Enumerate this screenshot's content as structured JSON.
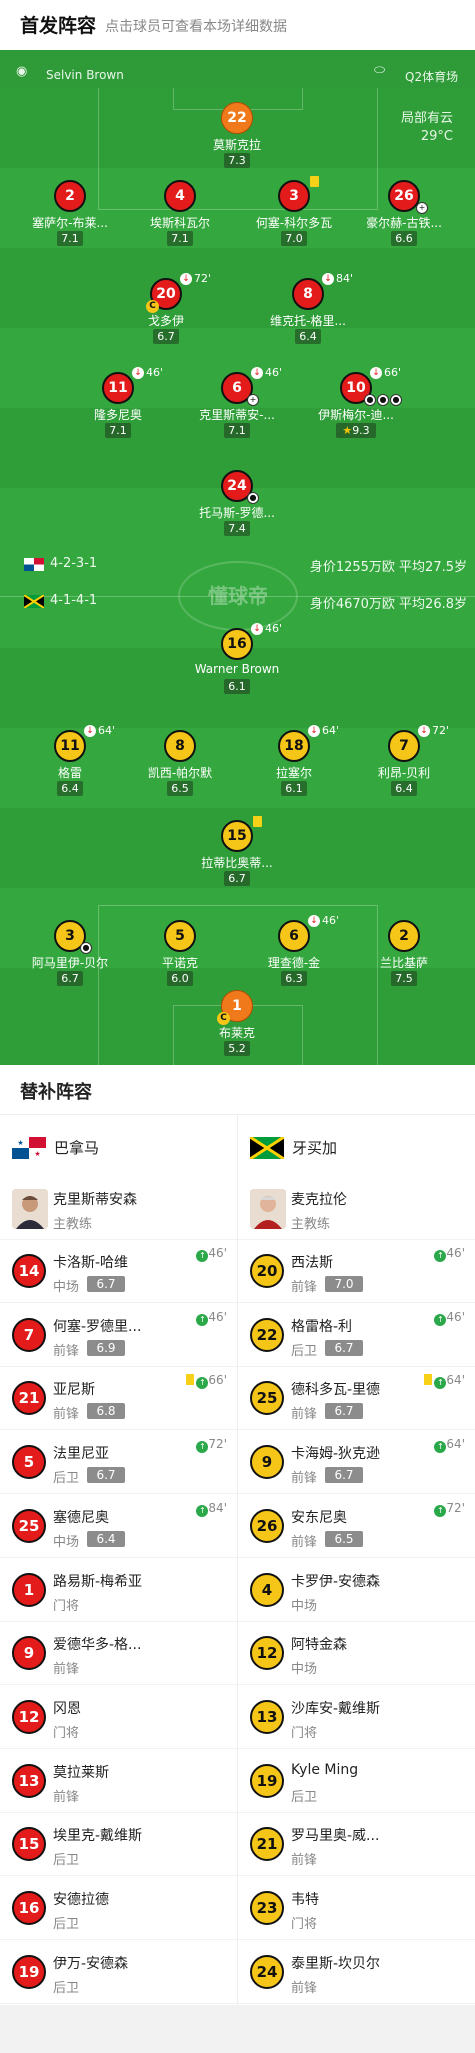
{
  "header": {
    "title": "首发阵容",
    "subtitle": "点击球员可查看本场详细数据"
  },
  "pitch": {
    "referee": "Selvin Brown",
    "venue": "Q2体育场",
    "weather_1": "局部有云",
    "weather_2": "29°C",
    "home": {
      "formation": "4-2-3-1",
      "value": "身价1255万欧 平均27.5岁"
    },
    "away": {
      "formation": "4-1-4-1",
      "value": "身价4670万欧 平均26.8岁"
    },
    "watermark": "懂球帝"
  },
  "home_players": [
    {
      "num": "22",
      "name": "莫斯克拉",
      "rating": "7.3"
    },
    {
      "num": "2",
      "name": "塞萨尔-布莱...",
      "rating": "7.1"
    },
    {
      "num": "4",
      "name": "埃斯科瓦尔",
      "rating": "7.1"
    },
    {
      "num": "3",
      "name": "何塞-科尔多瓦",
      "rating": "7.0"
    },
    {
      "num": "26",
      "name": "豪尔赫-古铁...",
      "rating": "6.6"
    },
    {
      "num": "20",
      "name": "戈多伊",
      "rating": "6.7",
      "sub": "72'"
    },
    {
      "num": "8",
      "name": "维克托-格里...",
      "rating": "6.4",
      "sub": "84'"
    },
    {
      "num": "11",
      "name": "隆多尼奥",
      "rating": "7.1",
      "sub": "46'"
    },
    {
      "num": "6",
      "name": "克里斯蒂安-...",
      "rating": "7.1",
      "sub": "46'"
    },
    {
      "num": "10",
      "name": "伊斯梅尔-迪...",
      "rating": "9.3",
      "sub": "66'"
    },
    {
      "num": "24",
      "name": "托马斯-罗德...",
      "rating": "7.4"
    }
  ],
  "away_players": [
    {
      "num": "16",
      "name": "Warner Brown",
      "rating": "6.1",
      "sub": "46'"
    },
    {
      "num": "11",
      "name": "格雷",
      "rating": "6.4",
      "sub": "64'"
    },
    {
      "num": "8",
      "name": "凯西-帕尔默",
      "rating": "6.5"
    },
    {
      "num": "18",
      "name": "拉塞尔",
      "rating": "6.1",
      "sub": "64'"
    },
    {
      "num": "7",
      "name": "利昂-贝利",
      "rating": "6.4",
      "sub": "72'"
    },
    {
      "num": "15",
      "name": "拉蒂比奥蒂...",
      "rating": "6.7"
    },
    {
      "num": "3",
      "name": "阿马里伊-贝尔",
      "rating": "6.7"
    },
    {
      "num": "5",
      "name": "平诺克",
      "rating": "6.0"
    },
    {
      "num": "6",
      "name": "理查德-金",
      "rating": "6.3",
      "sub": "46'"
    },
    {
      "num": "2",
      "name": "兰比基萨",
      "rating": "7.5"
    },
    {
      "num": "1",
      "name": "布莱克",
      "rating": "5.2"
    }
  ],
  "subs": {
    "title": "替补阵容",
    "home": {
      "team": "巴拿马",
      "coach": {
        "name": "克里斯蒂安森",
        "role": "主教练"
      },
      "players": [
        {
          "num": "14",
          "name": "卡洛斯-哈维",
          "pos": "中场",
          "rating": "6.7",
          "on": "46'"
        },
        {
          "num": "7",
          "name": "何塞-罗德里...",
          "pos": "前锋",
          "rating": "6.9",
          "on": "46'"
        },
        {
          "num": "21",
          "name": "亚尼斯",
          "pos": "前锋",
          "rating": "6.8",
          "on": "66'"
        },
        {
          "num": "5",
          "name": "法里尼亚",
          "pos": "后卫",
          "rating": "6.7",
          "on": "72'"
        },
        {
          "num": "25",
          "name": "塞德尼奥",
          "pos": "中场",
          "rating": "6.4",
          "on": "84'"
        },
        {
          "num": "1",
          "name": "路易斯-梅希亚",
          "pos": "门将"
        },
        {
          "num": "9",
          "name": "爱德华多-格...",
          "pos": "前锋"
        },
        {
          "num": "12",
          "name": "冈恩",
          "pos": "门将"
        },
        {
          "num": "13",
          "name": "莫拉莱斯",
          "pos": "前锋"
        },
        {
          "num": "15",
          "name": "埃里克-戴维斯",
          "pos": "后卫"
        },
        {
          "num": "16",
          "name": "安德拉德",
          "pos": "后卫"
        },
        {
          "num": "19",
          "name": "伊万-安德森",
          "pos": "后卫"
        }
      ]
    },
    "away": {
      "team": "牙买加",
      "coach": {
        "name": "麦克拉伦",
        "role": "主教练"
      },
      "players": [
        {
          "num": "20",
          "name": "西法斯",
          "pos": "前锋",
          "rating": "7.0",
          "on": "46'"
        },
        {
          "num": "22",
          "name": "格雷格-利",
          "pos": "后卫",
          "rating": "6.7",
          "on": "46'"
        },
        {
          "num": "25",
          "name": "德科多瓦-里德",
          "pos": "前锋",
          "rating": "6.7",
          "on": "64'"
        },
        {
          "num": "9",
          "name": "卡海姆-狄克逊",
          "pos": "前锋",
          "rating": "6.7",
          "on": "64'"
        },
        {
          "num": "26",
          "name": "安东尼奥",
          "pos": "前锋",
          "rating": "6.5",
          "on": "72'"
        },
        {
          "num": "4",
          "name": "卡罗伊-安德森",
          "pos": "中场"
        },
        {
          "num": "12",
          "name": "阿特金森",
          "pos": "中场"
        },
        {
          "num": "13",
          "name": "沙库安-戴维斯",
          "pos": "门将"
        },
        {
          "num": "19",
          "name": "Kyle Ming",
          "pos": "后卫"
        },
        {
          "num": "21",
          "name": "罗马里奥-威...",
          "pos": "前锋"
        },
        {
          "num": "23",
          "name": "韦特",
          "pos": "门将"
        },
        {
          "num": "24",
          "name": "泰里斯-坎贝尔",
          "pos": "前锋"
        }
      ]
    }
  }
}
